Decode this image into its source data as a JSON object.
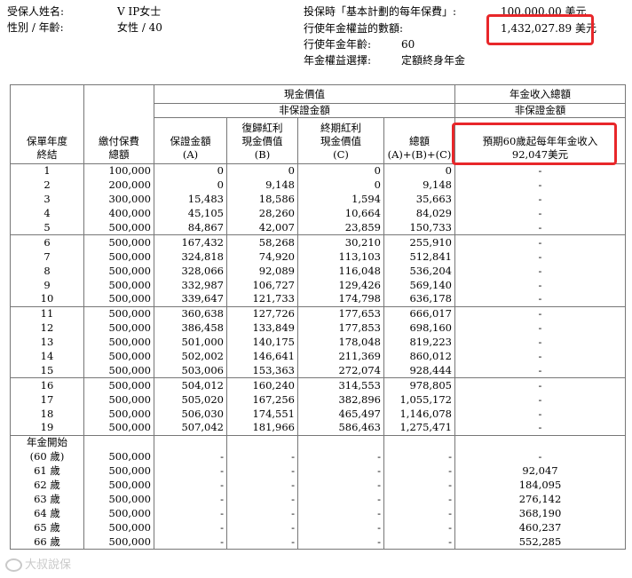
{
  "info": {
    "name_label": "受保人姓名:",
    "name_value": "V IP女士",
    "gender_age_label": "性別 / 年齡:",
    "gender_age_value": "女性 / 40",
    "premium_label": "投保時「基本計劃的每年保費」:",
    "premium_value": "100,000.00 美元",
    "exercise_amount_label": "行使年金權益的數額:",
    "exercise_amount_value": "1,432,027.89 美元",
    "exercise_age_label": "行使年金年齡:",
    "exercise_age_value": "60",
    "option_label": "年金權益選擇:",
    "option_value": "定額終身年金"
  },
  "headers": {
    "policy_year_1": "保單年度",
    "policy_year_2": "終結",
    "premium_1": "繳付保費",
    "premium_2": "總額",
    "cash_value": "現金價值",
    "non_guaranteed": "非保證金額",
    "guaranteed_1": "保證金額",
    "guaranteed_2": "(A)",
    "reversionary_1": "復歸紅利",
    "reversionary_2": "現金價值",
    "reversionary_3": "(B)",
    "terminal_1": "終期紅利",
    "terminal_2": "現金價值",
    "terminal_3": "(C)",
    "total_1": "總額",
    "total_2": "(A)+(B)+(C)",
    "annuity_total": "年金收入總額",
    "annuity_non_guaranteed": "非保證金額",
    "annuity_col_1": "預期60歲起每年年金收入",
    "annuity_col_2": "92,047美元"
  },
  "rows": [
    {
      "year": "1",
      "premium": "100,000",
      "a": "0",
      "b": "0",
      "c": "0",
      "total": "0",
      "annuity": "-"
    },
    {
      "year": "2",
      "premium": "200,000",
      "a": "0",
      "b": "9,148",
      "c": "0",
      "total": "9,148",
      "annuity": "-"
    },
    {
      "year": "3",
      "premium": "300,000",
      "a": "15,483",
      "b": "18,586",
      "c": "1,594",
      "total": "35,663",
      "annuity": "-"
    },
    {
      "year": "4",
      "premium": "400,000",
      "a": "45,105",
      "b": "28,260",
      "c": "10,664",
      "total": "84,029",
      "annuity": "-"
    },
    {
      "year": "5",
      "premium": "500,000",
      "a": "84,867",
      "b": "42,007",
      "c": "23,859",
      "total": "150,733",
      "annuity": "-"
    },
    {
      "year": "6",
      "premium": "500,000",
      "a": "167,432",
      "b": "58,268",
      "c": "30,210",
      "total": "255,910",
      "annuity": "-"
    },
    {
      "year": "7",
      "premium": "500,000",
      "a": "324,818",
      "b": "74,920",
      "c": "113,103",
      "total": "512,841",
      "annuity": "-"
    },
    {
      "year": "8",
      "premium": "500,000",
      "a": "328,066",
      "b": "92,089",
      "c": "116,048",
      "total": "536,204",
      "annuity": "-"
    },
    {
      "year": "9",
      "premium": "500,000",
      "a": "332,987",
      "b": "106,727",
      "c": "129,426",
      "total": "569,140",
      "annuity": "-"
    },
    {
      "year": "10",
      "premium": "500,000",
      "a": "339,647",
      "b": "121,733",
      "c": "174,798",
      "total": "636,178",
      "annuity": "-"
    },
    {
      "year": "11",
      "premium": "500,000",
      "a": "360,638",
      "b": "127,726",
      "c": "177,653",
      "total": "666,017",
      "annuity": "-"
    },
    {
      "year": "12",
      "premium": "500,000",
      "a": "386,458",
      "b": "133,849",
      "c": "177,853",
      "total": "698,160",
      "annuity": "-"
    },
    {
      "year": "13",
      "premium": "500,000",
      "a": "501,000",
      "b": "140,175",
      "c": "178,048",
      "total": "819,223",
      "annuity": "-"
    },
    {
      "year": "14",
      "premium": "500,000",
      "a": "502,002",
      "b": "146,641",
      "c": "211,369",
      "total": "860,012",
      "annuity": "-"
    },
    {
      "year": "15",
      "premium": "500,000",
      "a": "503,006",
      "b": "153,363",
      "c": "272,074",
      "total": "928,444",
      "annuity": "-"
    },
    {
      "year": "16",
      "premium": "500,000",
      "a": "504,012",
      "b": "160,240",
      "c": "314,553",
      "total": "978,805",
      "annuity": "-"
    },
    {
      "year": "17",
      "premium": "500,000",
      "a": "505,020",
      "b": "167,256",
      "c": "382,896",
      "total": "1,055,172",
      "annuity": "-"
    },
    {
      "year": "18",
      "premium": "500,000",
      "a": "506,030",
      "b": "174,551",
      "c": "465,497",
      "total": "1,146,078",
      "annuity": "-"
    },
    {
      "year": "19",
      "premium": "500,000",
      "a": "507,042",
      "b": "181,966",
      "c": "586,463",
      "total": "1,275,471",
      "annuity": "-"
    },
    {
      "year": "年金開始",
      "premium": "",
      "a": "",
      "b": "",
      "c": "",
      "total": "",
      "annuity": ""
    },
    {
      "year": "(60 歲)",
      "premium": "500,000",
      "a": "-",
      "b": "-",
      "c": "-",
      "total": "-",
      "annuity": "-"
    },
    {
      "year": "61 歲",
      "premium": "500,000",
      "a": "-",
      "b": "-",
      "c": "-",
      "total": "-",
      "annuity": "92,047"
    },
    {
      "year": "62 歲",
      "premium": "500,000",
      "a": "-",
      "b": "-",
      "c": "-",
      "total": "-",
      "annuity": "184,095"
    },
    {
      "year": "63 歲",
      "premium": "500,000",
      "a": "-",
      "b": "-",
      "c": "-",
      "total": "-",
      "annuity": "276,142"
    },
    {
      "year": "64 歲",
      "premium": "500,000",
      "a": "-",
      "b": "-",
      "c": "-",
      "total": "-",
      "annuity": "368,190"
    },
    {
      "year": "65 歲",
      "premium": "500,000",
      "a": "-",
      "b": "-",
      "c": "-",
      "total": "-",
      "annuity": "460,237"
    },
    {
      "year": "66 歲",
      "premium": "500,000",
      "a": "-",
      "b": "-",
      "c": "-",
      "total": "-",
      "annuity": "552,285"
    }
  ],
  "watermark": "大叔說保",
  "highlight_color": "#e8272a"
}
